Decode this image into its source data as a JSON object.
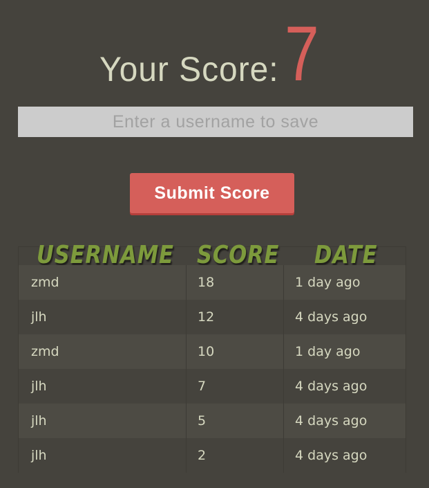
{
  "score": {
    "label": "Your Score:",
    "value": "7"
  },
  "form": {
    "username_placeholder": "Enter a username to save",
    "username_value": "",
    "submit_label": "Submit Score"
  },
  "table": {
    "columns": [
      "USERNAME",
      "SCORE",
      "DATE"
    ],
    "rows": [
      {
        "username": "zmd",
        "score": "18",
        "date": "1 day ago"
      },
      {
        "username": "jlh",
        "score": "12",
        "date": "4 days ago"
      },
      {
        "username": "zmd",
        "score": "10",
        "date": "1 day ago"
      },
      {
        "username": "jlh",
        "score": "7",
        "date": "4 days ago"
      },
      {
        "username": "jlh",
        "score": "5",
        "date": "4 days ago"
      },
      {
        "username": "jlh",
        "score": "2",
        "date": "4 days ago"
      }
    ]
  },
  "colors": {
    "background": "#45433d",
    "accent_red": "#d55f5a",
    "header_green": "#7d9a3c",
    "text_light": "#d6d8c0",
    "input_bg": "#cccccc"
  }
}
